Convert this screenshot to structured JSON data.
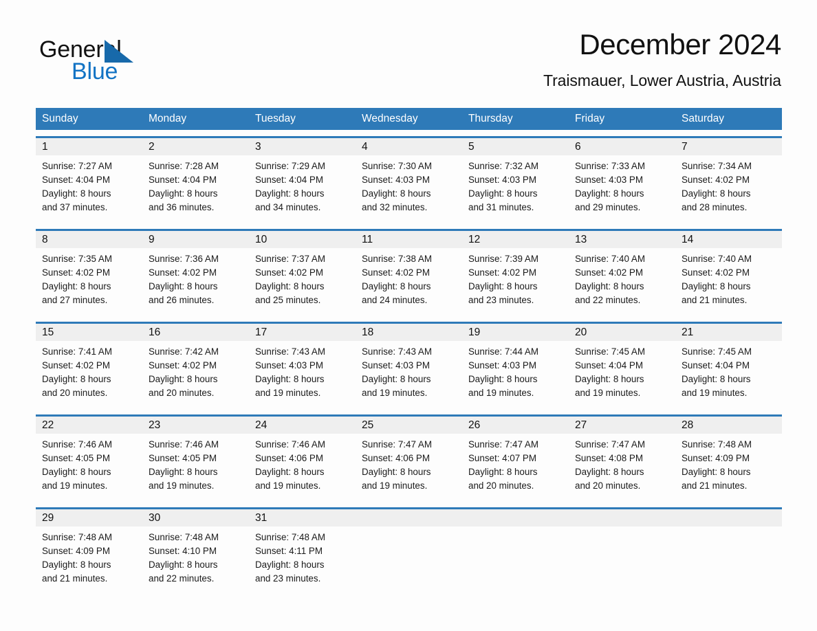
{
  "brand": {
    "name_part1": "General",
    "name_part2": "Blue",
    "triangle_color": "#1769aa",
    "blue_color": "#1273c4"
  },
  "header": {
    "title": "December 2024",
    "subtitle": "Traismauer, Lower Austria, Austria"
  },
  "calendar": {
    "accent_color": "#2e7ab8",
    "daynum_band_color": "#efefef",
    "weekdays": [
      "Sunday",
      "Monday",
      "Tuesday",
      "Wednesday",
      "Thursday",
      "Friday",
      "Saturday"
    ],
    "weeks": [
      {
        "daynums": [
          "1",
          "2",
          "3",
          "4",
          "5",
          "6",
          "7"
        ],
        "cells": [
          {
            "sunrise": "Sunrise: 7:27 AM",
            "sunset": "Sunset: 4:04 PM",
            "daylight_line1": "Daylight: 8 hours",
            "daylight_line2": "and 37 minutes."
          },
          {
            "sunrise": "Sunrise: 7:28 AM",
            "sunset": "Sunset: 4:04 PM",
            "daylight_line1": "Daylight: 8 hours",
            "daylight_line2": "and 36 minutes."
          },
          {
            "sunrise": "Sunrise: 7:29 AM",
            "sunset": "Sunset: 4:04 PM",
            "daylight_line1": "Daylight: 8 hours",
            "daylight_line2": "and 34 minutes."
          },
          {
            "sunrise": "Sunrise: 7:30 AM",
            "sunset": "Sunset: 4:03 PM",
            "daylight_line1": "Daylight: 8 hours",
            "daylight_line2": "and 32 minutes."
          },
          {
            "sunrise": "Sunrise: 7:32 AM",
            "sunset": "Sunset: 4:03 PM",
            "daylight_line1": "Daylight: 8 hours",
            "daylight_line2": "and 31 minutes."
          },
          {
            "sunrise": "Sunrise: 7:33 AM",
            "sunset": "Sunset: 4:03 PM",
            "daylight_line1": "Daylight: 8 hours",
            "daylight_line2": "and 29 minutes."
          },
          {
            "sunrise": "Sunrise: 7:34 AM",
            "sunset": "Sunset: 4:02 PM",
            "daylight_line1": "Daylight: 8 hours",
            "daylight_line2": "and 28 minutes."
          }
        ]
      },
      {
        "daynums": [
          "8",
          "9",
          "10",
          "11",
          "12",
          "13",
          "14"
        ],
        "cells": [
          {
            "sunrise": "Sunrise: 7:35 AM",
            "sunset": "Sunset: 4:02 PM",
            "daylight_line1": "Daylight: 8 hours",
            "daylight_line2": "and 27 minutes."
          },
          {
            "sunrise": "Sunrise: 7:36 AM",
            "sunset": "Sunset: 4:02 PM",
            "daylight_line1": "Daylight: 8 hours",
            "daylight_line2": "and 26 minutes."
          },
          {
            "sunrise": "Sunrise: 7:37 AM",
            "sunset": "Sunset: 4:02 PM",
            "daylight_line1": "Daylight: 8 hours",
            "daylight_line2": "and 25 minutes."
          },
          {
            "sunrise": "Sunrise: 7:38 AM",
            "sunset": "Sunset: 4:02 PM",
            "daylight_line1": "Daylight: 8 hours",
            "daylight_line2": "and 24 minutes."
          },
          {
            "sunrise": "Sunrise: 7:39 AM",
            "sunset": "Sunset: 4:02 PM",
            "daylight_line1": "Daylight: 8 hours",
            "daylight_line2": "and 23 minutes."
          },
          {
            "sunrise": "Sunrise: 7:40 AM",
            "sunset": "Sunset: 4:02 PM",
            "daylight_line1": "Daylight: 8 hours",
            "daylight_line2": "and 22 minutes."
          },
          {
            "sunrise": "Sunrise: 7:40 AM",
            "sunset": "Sunset: 4:02 PM",
            "daylight_line1": "Daylight: 8 hours",
            "daylight_line2": "and 21 minutes."
          }
        ]
      },
      {
        "daynums": [
          "15",
          "16",
          "17",
          "18",
          "19",
          "20",
          "21"
        ],
        "cells": [
          {
            "sunrise": "Sunrise: 7:41 AM",
            "sunset": "Sunset: 4:02 PM",
            "daylight_line1": "Daylight: 8 hours",
            "daylight_line2": "and 20 minutes."
          },
          {
            "sunrise": "Sunrise: 7:42 AM",
            "sunset": "Sunset: 4:02 PM",
            "daylight_line1": "Daylight: 8 hours",
            "daylight_line2": "and 20 minutes."
          },
          {
            "sunrise": "Sunrise: 7:43 AM",
            "sunset": "Sunset: 4:03 PM",
            "daylight_line1": "Daylight: 8 hours",
            "daylight_line2": "and 19 minutes."
          },
          {
            "sunrise": "Sunrise: 7:43 AM",
            "sunset": "Sunset: 4:03 PM",
            "daylight_line1": "Daylight: 8 hours",
            "daylight_line2": "and 19 minutes."
          },
          {
            "sunrise": "Sunrise: 7:44 AM",
            "sunset": "Sunset: 4:03 PM",
            "daylight_line1": "Daylight: 8 hours",
            "daylight_line2": "and 19 minutes."
          },
          {
            "sunrise": "Sunrise: 7:45 AM",
            "sunset": "Sunset: 4:04 PM",
            "daylight_line1": "Daylight: 8 hours",
            "daylight_line2": "and 19 minutes."
          },
          {
            "sunrise": "Sunrise: 7:45 AM",
            "sunset": "Sunset: 4:04 PM",
            "daylight_line1": "Daylight: 8 hours",
            "daylight_line2": "and 19 minutes."
          }
        ]
      },
      {
        "daynums": [
          "22",
          "23",
          "24",
          "25",
          "26",
          "27",
          "28"
        ],
        "cells": [
          {
            "sunrise": "Sunrise: 7:46 AM",
            "sunset": "Sunset: 4:05 PM",
            "daylight_line1": "Daylight: 8 hours",
            "daylight_line2": "and 19 minutes."
          },
          {
            "sunrise": "Sunrise: 7:46 AM",
            "sunset": "Sunset: 4:05 PM",
            "daylight_line1": "Daylight: 8 hours",
            "daylight_line2": "and 19 minutes."
          },
          {
            "sunrise": "Sunrise: 7:46 AM",
            "sunset": "Sunset: 4:06 PM",
            "daylight_line1": "Daylight: 8 hours",
            "daylight_line2": "and 19 minutes."
          },
          {
            "sunrise": "Sunrise: 7:47 AM",
            "sunset": "Sunset: 4:06 PM",
            "daylight_line1": "Daylight: 8 hours",
            "daylight_line2": "and 19 minutes."
          },
          {
            "sunrise": "Sunrise: 7:47 AM",
            "sunset": "Sunset: 4:07 PM",
            "daylight_line1": "Daylight: 8 hours",
            "daylight_line2": "and 20 minutes."
          },
          {
            "sunrise": "Sunrise: 7:47 AM",
            "sunset": "Sunset: 4:08 PM",
            "daylight_line1": "Daylight: 8 hours",
            "daylight_line2": "and 20 minutes."
          },
          {
            "sunrise": "Sunrise: 7:48 AM",
            "sunset": "Sunset: 4:09 PM",
            "daylight_line1": "Daylight: 8 hours",
            "daylight_line2": "and 21 minutes."
          }
        ]
      },
      {
        "daynums": [
          "29",
          "30",
          "31",
          "",
          "",
          "",
          ""
        ],
        "cells": [
          {
            "sunrise": "Sunrise: 7:48 AM",
            "sunset": "Sunset: 4:09 PM",
            "daylight_line1": "Daylight: 8 hours",
            "daylight_line2": "and 21 minutes."
          },
          {
            "sunrise": "Sunrise: 7:48 AM",
            "sunset": "Sunset: 4:10 PM",
            "daylight_line1": "Daylight: 8 hours",
            "daylight_line2": "and 22 minutes."
          },
          {
            "sunrise": "Sunrise: 7:48 AM",
            "sunset": "Sunset: 4:11 PM",
            "daylight_line1": "Daylight: 8 hours",
            "daylight_line2": "and 23 minutes."
          },
          {
            "sunrise": "",
            "sunset": "",
            "daylight_line1": "",
            "daylight_line2": ""
          },
          {
            "sunrise": "",
            "sunset": "",
            "daylight_line1": "",
            "daylight_line2": ""
          },
          {
            "sunrise": "",
            "sunset": "",
            "daylight_line1": "",
            "daylight_line2": ""
          },
          {
            "sunrise": "",
            "sunset": "",
            "daylight_line1": "",
            "daylight_line2": ""
          }
        ]
      }
    ]
  }
}
